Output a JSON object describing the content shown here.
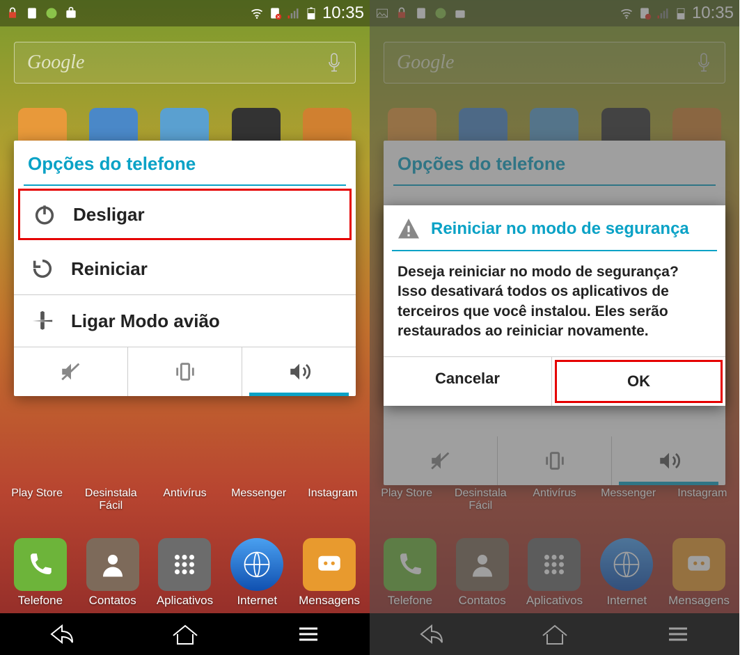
{
  "status": {
    "time": "10:35"
  },
  "search": {
    "placeholder": "Google"
  },
  "dialog": {
    "title": "Opções do telefone",
    "options": [
      {
        "label": "Desligar"
      },
      {
        "label": "Reiniciar"
      },
      {
        "label": "Ligar Modo avião"
      }
    ]
  },
  "confirm": {
    "title": "Reiniciar no modo de segurança",
    "body": "Deseja reiniciar no modo de segurança? Isso desativará todos os aplicativos de terceiros que você instalou. Eles serão restaurados ao reiniciar novamente.",
    "cancel": "Cancelar",
    "ok": "OK"
  },
  "midrow_labels": [
    "Play Store",
    "Desinstala Fácil",
    "Antivírus",
    "Messenger",
    "Instagram"
  ],
  "dock": [
    {
      "label": "Telefone",
      "color": "#6db43a",
      "icon": "phone"
    },
    {
      "label": "Contatos",
      "color": "#7d6a5a",
      "icon": "contact"
    },
    {
      "label": "Aplicativos",
      "color": "#6c6c6c",
      "icon": "grid"
    },
    {
      "label": "Internet",
      "color": "#1e6ad4",
      "icon": "globe"
    },
    {
      "label": "Mensagens",
      "color": "#e89a2e",
      "icon": "msg"
    }
  ]
}
